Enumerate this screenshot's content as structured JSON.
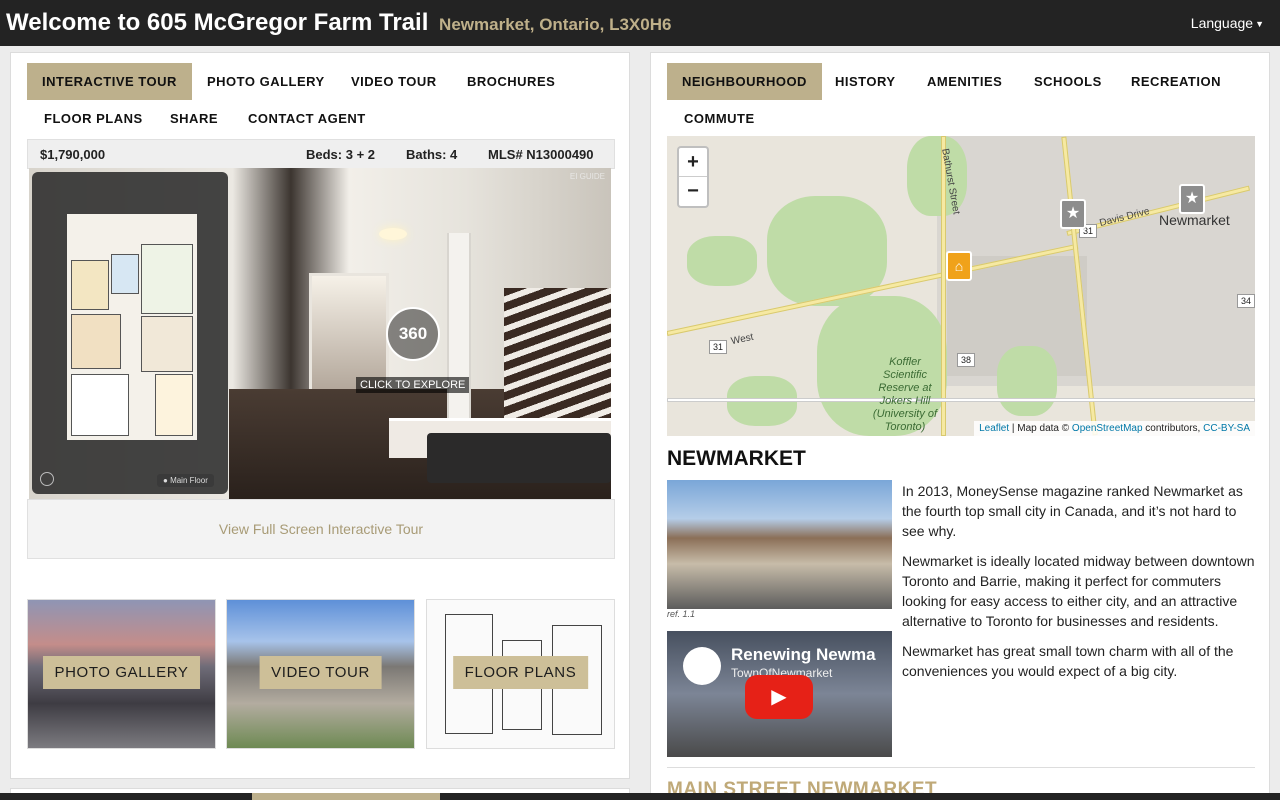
{
  "header": {
    "title": "Welcome to 605 McGregor Farm Trail",
    "subtitle": "Newmarket, Ontario, L3X0H6",
    "language_label": "Language"
  },
  "left_tabs": [
    "INTERACTIVE TOUR",
    "PHOTO GALLERY",
    "VIDEO TOUR",
    "BROCHURES",
    "FLOOR PLANS",
    "SHARE",
    "CONTACT AGENT"
  ],
  "listing": {
    "price": "$1,790,000",
    "beds": "Beds: 3 + 2",
    "baths": "Baths: 4",
    "mls": "MLS# N13000490"
  },
  "tour": {
    "badge": "360",
    "cta": "CLICK TO EXPLORE",
    "floor_label": "Main Floor",
    "brand": "EI GUIDE",
    "fullscreen_link": "View Full Screen Interactive Tour"
  },
  "thumbs": [
    {
      "label": "PHOTO GALLERY"
    },
    {
      "label": "VIDEO TOUR"
    },
    {
      "label": "FLOOR PLANS"
    }
  ],
  "right_tabs": [
    "NEIGHBOURHOOD",
    "HISTORY",
    "AMENITIES",
    "SCHOOLS",
    "RECREATION",
    "COMMUTE"
  ],
  "map": {
    "zoom_in": "+",
    "zoom_out": "−",
    "city_label": "Newmarket",
    "labels": {
      "bathurst": "Bathurst Street",
      "davis": "Davis Drive",
      "west": "West",
      "koffler": "Koffler Scientific Reserve at Jokers Hill (University of Toronto)"
    },
    "shields": [
      "31",
      "31",
      "38",
      "34"
    ],
    "attribution": {
      "leaflet": "Leaflet",
      "sep": " | Map data © ",
      "osm": "OpenStreetMap",
      "contrib": " contributors, ",
      "license": "CC-BY-SA"
    }
  },
  "neighbourhood": {
    "title": "NEWMARKET",
    "photo_ref": "ref. 1.1",
    "video_title": "Renewing Newma",
    "video_channel": "TownOfNewmarket",
    "paragraphs": [
      "In 2013, MoneySense magazine ranked Newmarket as the fourth top small city in Canada, and it’s not hard to see why.",
      "Newmarket is ideally located midway between downtown Toronto and Barrie, making it perfect for commuters looking for easy access to either city, and an attractive alternative to Toronto for businesses and residents.",
      "Newmarket has great small town charm with all of the conveniences you would expect of a big city."
    ],
    "next_section": "MAIN STREET NEWMARKET"
  },
  "colors": {
    "accent": "#bdb08c",
    "header_bg": "#232323",
    "subtitle": "#bfb08a",
    "link": "#a89b76"
  }
}
